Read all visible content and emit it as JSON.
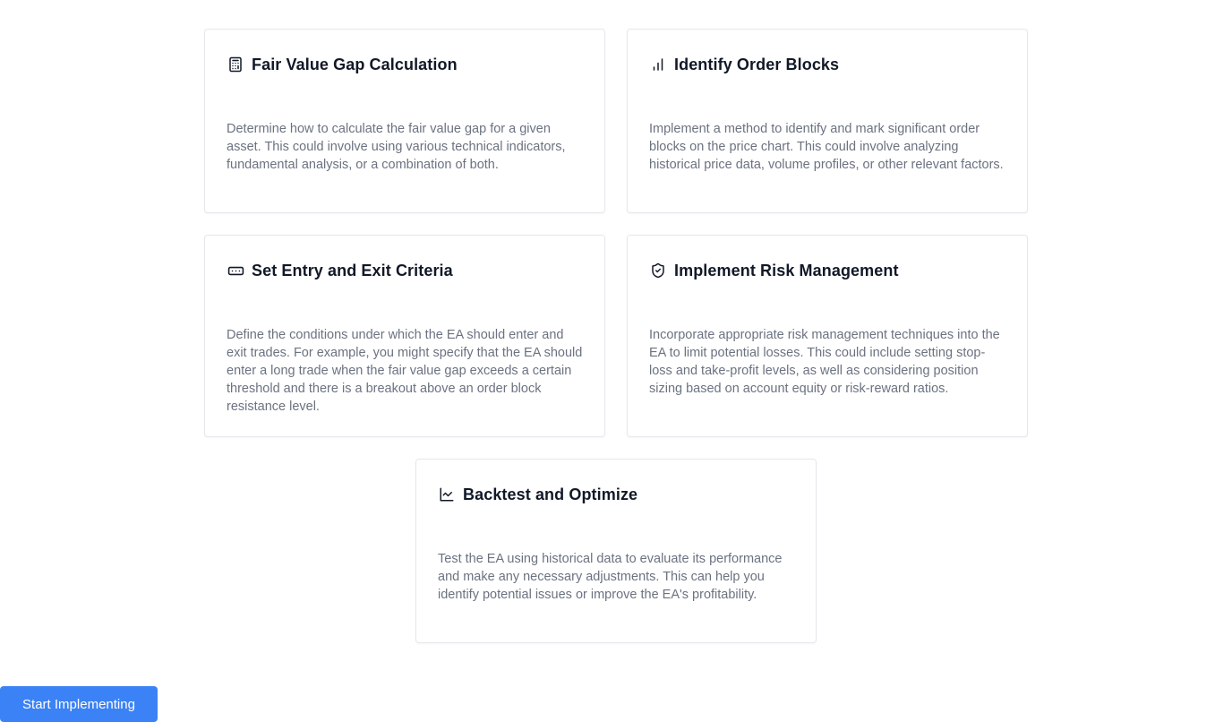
{
  "cards": [
    {
      "title": "Fair Value Gap Calculation",
      "icon": "calculator-icon",
      "description": "Determine how to calculate the fair value gap for a given asset. This could involve using various technical indicators, fundamental analysis, or a combination of both."
    },
    {
      "title": "Identify Order Blocks",
      "icon": "bar-chart-icon",
      "description": "Implement a method to identify and mark significant order blocks on the price chart. This could involve analyzing historical price data, volume profiles, or other relevant factors."
    },
    {
      "title": "Set Entry and Exit Criteria",
      "icon": "rectangle-ellipsis-icon",
      "description": "Define the conditions under which the EA should enter and exit trades. For example, you might specify that the EA should enter a long trade when the fair value gap exceeds a certain threshold and there is a breakout above an order block resistance level."
    },
    {
      "title": "Implement Risk Management",
      "icon": "shield-check-icon",
      "description": "Incorporate appropriate risk management techniques into the EA to limit potential losses. This could include setting stop-loss and take-profit levels, as well as considering position sizing based on account equity or risk-reward ratios."
    },
    {
      "title": "Backtest and Optimize",
      "icon": "line-chart-icon",
      "description": "Test the EA using historical data to evaluate its performance and make any necessary adjustments. This can help you identify potential issues or improve the EA's profitability."
    }
  ],
  "actions": {
    "start_label": "Start Implementing"
  },
  "colors": {
    "accent": "#3b82f6",
    "text": "#111827",
    "muted": "#6b7280",
    "border": "#e5e7eb"
  }
}
